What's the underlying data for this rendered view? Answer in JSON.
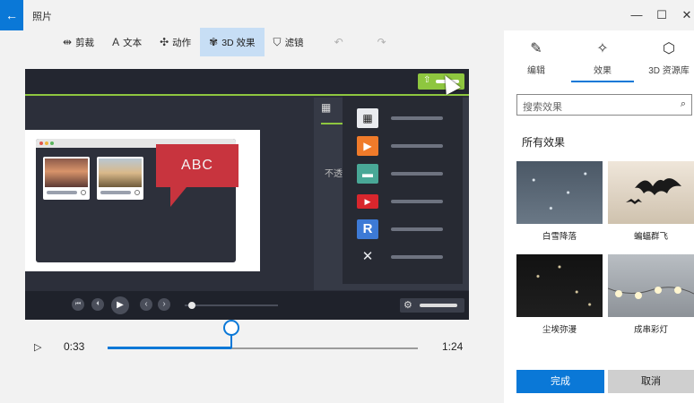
{
  "titlebar": {
    "back_icon": "←",
    "app_title": "照片",
    "min_icon": "—",
    "max_icon": "☐",
    "close_icon": "✕"
  },
  "toolbar": {
    "items": [
      {
        "icon": "trim-icon",
        "glyph": "⇹",
        "label": "剪裁"
      },
      {
        "icon": "text-icon",
        "glyph": "A",
        "label": "文本"
      },
      {
        "icon": "motion-icon",
        "glyph": "✣",
        "label": "动作"
      },
      {
        "icon": "3d-effects-icon",
        "glyph": "✾",
        "label": "3D 效果",
        "active": true
      },
      {
        "icon": "filter-icon",
        "glyph": "⛉",
        "label": "滤镜"
      }
    ],
    "undo_glyph": "↶",
    "redo_glyph": "↷"
  },
  "video": {
    "slide_heading": "ABC",
    "side_panel_text": "不透",
    "share_glyph": "⇧",
    "menu_icons": [
      {
        "name": "filmstrip-icon",
        "glyph": "▦",
        "color": "#e9ebef"
      },
      {
        "name": "play-orange-icon",
        "glyph": "▶",
        "color": "#f07b2a"
      },
      {
        "name": "chat-teal-icon",
        "glyph": "▬",
        "color": "#49a897"
      },
      {
        "name": "youtube-icon",
        "glyph": "▶",
        "color": "#d8262d"
      },
      {
        "name": "r-logo-icon",
        "glyph": "R",
        "color": "#3d7ad6"
      },
      {
        "name": "tools-icon",
        "glyph": "✕",
        "color": "#e9ebef"
      }
    ],
    "controls": {
      "skip_back": "⏮",
      "step_back": "⏴",
      "play": "▶",
      "prev": "‹",
      "next": "›",
      "gear": "⚙"
    }
  },
  "playback": {
    "play_glyph": "▷",
    "current_time": "0:33",
    "total_time": "1:24",
    "progress": 0.4
  },
  "right_pane": {
    "tabs": [
      {
        "label": "编辑",
        "glyph": "✎",
        "icon": "edit-icon"
      },
      {
        "label": "效果",
        "glyph": "✧",
        "icon": "effects-icon",
        "active": true
      },
      {
        "label": "3D 资源库",
        "glyph": "⬡",
        "icon": "3d-library-icon"
      }
    ],
    "search_placeholder": "搜索效果",
    "search_glyph": "⌕",
    "section_title": "所有效果",
    "effects": [
      {
        "label": "白雪降落"
      },
      {
        "label": "蝙蝠群飞"
      },
      {
        "label": "尘埃弥漫"
      },
      {
        "label": "成串彩灯"
      }
    ],
    "done_label": "完成",
    "cancel_label": "取消"
  },
  "colors": {
    "accent": "#0a78d7",
    "green": "#8ec63f",
    "abc_red": "#c8343e"
  }
}
